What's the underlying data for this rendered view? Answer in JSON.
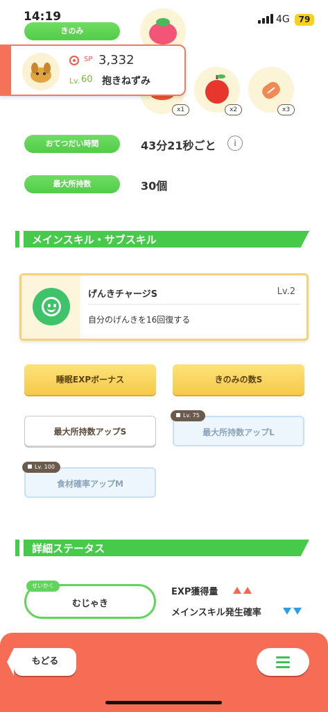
{
  "status_bar": {
    "time": "14:19",
    "network": "4G",
    "battery": "79"
  },
  "berries": {
    "label": "きのみ",
    "items": [
      {
        "name": "red-berry",
        "count": "x1"
      },
      {
        "name": "apple",
        "count": "x2"
      },
      {
        "name": "sausage",
        "count": "x3"
      }
    ]
  },
  "pokemon": {
    "sp_label": "SP",
    "sp_value": "3,332",
    "lv_label": "Lv.",
    "lv_value": "60",
    "name": "抱きねずみ"
  },
  "stats": {
    "help_time_label": "おてつだい時間",
    "help_time_value": "43分21秒ごと",
    "max_capacity_label": "最大所持数",
    "max_capacity_value": "30個"
  },
  "skills_section": {
    "title": "メインスキル・サブスキル",
    "main_skill": {
      "name": "げんきチャージS",
      "level": "Lv.2",
      "description": "自分のげんきを16回復する"
    },
    "subskills": [
      {
        "label": "睡眠EXPボーナス",
        "style": "gold",
        "locked": false
      },
      {
        "label": "きのみの数S",
        "style": "gold",
        "locked": false
      },
      {
        "label": "最大所持数アップS",
        "style": "white",
        "locked": false
      },
      {
        "label": "最大所持数アップL",
        "style": "locked",
        "locked": true,
        "lock_level": "Lv. 75"
      },
      {
        "label": "食材確率アップM",
        "style": "locked",
        "locked": true,
        "lock_level": "Lv. 100"
      }
    ]
  },
  "details_section": {
    "title": "詳細ステータス",
    "nature_tag": "せいかく",
    "nature_value": "むじゃき",
    "effects": [
      {
        "label": "EXP獲得量",
        "direction": "up",
        "color": "#f26a4a"
      },
      {
        "label": "メインスキル発生確率",
        "direction": "down",
        "color": "#2f9ce8"
      }
    ]
  },
  "bottom_bar": {
    "back_label": "もどる",
    "menu_icon": "hamburger-menu-icon"
  },
  "colors": {
    "accent_green": "#47c94a",
    "header_orange": "#f76c55",
    "gold": "#f6c94a"
  }
}
